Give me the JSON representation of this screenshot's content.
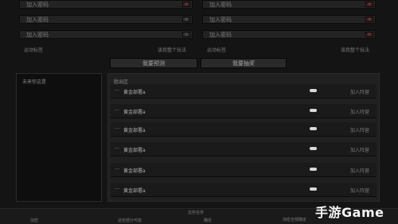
{
  "top_fields": {
    "left": [
      "加入密码",
      "加入密码",
      "加入密码"
    ],
    "right": [
      "加入密码",
      "加入密码",
      "加入密码"
    ]
  },
  "notes": {
    "left_small": "运动标签",
    "left_hint": "该我整个玩法",
    "right_small": "运动标签",
    "right_hint": "该我整个玩法"
  },
  "buttons": {
    "create": "我要预测",
    "cancel": "我要抽奖"
  },
  "left_panel": {
    "title": "未来你这是"
  },
  "right_panel": {
    "title": "胜出区",
    "rows": [
      {
        "name": "黄金部署a",
        "action": "加入阵营"
      },
      {
        "name": "黄金部署a",
        "action": "加入阵营"
      },
      {
        "name": "黄金部署a",
        "action": "加入阵营"
      },
      {
        "name": "黄金部署a",
        "action": "加入阵营"
      },
      {
        "name": "黄金部署a",
        "action": "加入阵营"
      },
      {
        "name": "黄金部署a",
        "action": "加入阵营"
      }
    ]
  },
  "bottom": {
    "center": "这些任务",
    "col1": "加密",
    "col2": "这些部分可能",
    "col3": "确定",
    "col4": "加密全部确定"
  },
  "watermark": {
    "brand": "手游",
    "suffix": "Game"
  },
  "colors": {
    "background": "#141414",
    "panel": "#202020",
    "accent_red": "#3a1e1e"
  }
}
